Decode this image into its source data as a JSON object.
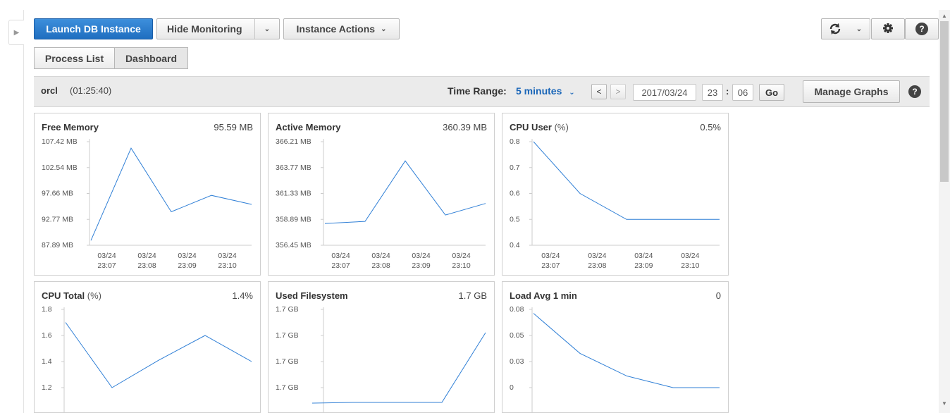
{
  "toolbar": {
    "launch_label": "Launch DB Instance",
    "hide_monitoring_label": "Hide Monitoring",
    "instance_actions_label": "Instance Actions",
    "refresh_icon": "refresh-icon",
    "settings_icon": "gear-icon",
    "help_icon": "help-icon"
  },
  "tabs": [
    {
      "label": "Process List"
    },
    {
      "label": "Dashboard"
    }
  ],
  "header": {
    "instance": "orcl",
    "uptime": "(01:25:40)",
    "time_range_label": "Time Range:",
    "time_range_value": "5 minutes",
    "prev_label": "<",
    "next_label": ">",
    "date": "2017/03/24",
    "hour": "23",
    "separator": ":",
    "minute": "06",
    "go_label": "Go",
    "manage_graphs_label": "Manage Graphs",
    "help_label": "?"
  },
  "colors": {
    "line": "#2f7fd6",
    "primary": "#2476c9",
    "link": "#1a66b8"
  },
  "cards": [
    {
      "title": "Free Memory",
      "unit": "",
      "value": "95.59 MB",
      "y_ticks": [
        "107.42 MB",
        "102.54 MB",
        "97.66 MB",
        "92.77 MB",
        "87.89 MB"
      ],
      "x_ticks": [
        [
          "03/24",
          "23:07"
        ],
        [
          "03/24",
          "23:08"
        ],
        [
          "03/24",
          "23:09"
        ],
        [
          "03/24",
          "23:10"
        ]
      ]
    },
    {
      "title": "Active Memory",
      "unit": "",
      "value": "360.39 MB",
      "y_ticks": [
        "366.21 MB",
        "363.77 MB",
        "361.33 MB",
        "358.89 MB",
        "356.45 MB"
      ],
      "x_ticks": [
        [
          "03/24",
          "23:07"
        ],
        [
          "03/24",
          "23:08"
        ],
        [
          "03/24",
          "23:09"
        ],
        [
          "03/24",
          "23:10"
        ]
      ]
    },
    {
      "title": "CPU User",
      "unit": " (%)",
      "value": "0.5%",
      "y_ticks": [
        "0.8",
        "0.7",
        "0.6",
        "0.5",
        "0.4"
      ],
      "x_ticks": [
        [
          "03/24",
          "23:07"
        ],
        [
          "03/24",
          "23:08"
        ],
        [
          "03/24",
          "23:09"
        ],
        [
          "03/24",
          "23:10"
        ]
      ]
    },
    {
      "title": "CPU Total",
      "unit": " (%)",
      "value": "1.4%",
      "y_ticks": [
        "1.8",
        "1.6",
        "1.4",
        "1.2"
      ],
      "x_ticks": []
    },
    {
      "title": "Used Filesystem",
      "unit": "",
      "value": "1.7 GB",
      "y_ticks": [
        "1.7 GB",
        "1.7 GB",
        "1.7 GB",
        "1.7 GB"
      ],
      "x_ticks": []
    },
    {
      "title": "Load Avg 1 min",
      "unit": "",
      "value": "0",
      "y_ticks": [
        "0.08",
        "0.05",
        "0.03",
        "0"
      ],
      "x_ticks": []
    }
  ],
  "chart_data": [
    {
      "type": "line",
      "title": "Free Memory",
      "ylabel": "",
      "ylim": [
        87.89,
        107.42
      ],
      "x": [
        "23:06:40",
        "23:07:40",
        "23:08:40",
        "23:09:40",
        "23:10:40"
      ],
      "values": [
        88.8,
        106.2,
        94.2,
        97.3,
        95.59
      ]
    },
    {
      "type": "line",
      "title": "Active Memory",
      "ylabel": "",
      "ylim": [
        356.45,
        366.21
      ],
      "x": [
        "23:06:40",
        "23:07:40",
        "23:08:40",
        "23:09:40",
        "23:10:40"
      ],
      "values": [
        358.5,
        358.7,
        364.4,
        359.3,
        360.39
      ]
    },
    {
      "type": "line",
      "title": "CPU User (%)",
      "ylabel": "",
      "ylim": [
        0.4,
        0.8
      ],
      "x": [
        "23:06:40",
        "23:07:40",
        "23:08:40",
        "23:09:40",
        "23:10:40"
      ],
      "values": [
        0.8,
        0.6,
        0.5,
        0.5,
        0.5
      ]
    },
    {
      "type": "line",
      "title": "CPU Total (%)",
      "ylabel": "",
      "ylim": [
        1.1,
        1.8
      ],
      "x": [
        "23:06:40",
        "23:07:40",
        "23:08:40",
        "23:09:40",
        "23:10:40"
      ],
      "values": [
        1.7,
        1.2,
        1.41,
        1.6,
        1.4
      ]
    },
    {
      "type": "line",
      "title": "Used Filesystem",
      "ylabel": "",
      "ylim": [
        0,
        1
      ],
      "x": [
        "23:06:40",
        "23:07:40",
        "23:08:40",
        "23:09:40",
        "23:10:40"
      ],
      "values": [
        0.0,
        0.005,
        0.005,
        0.005,
        0.8
      ]
    },
    {
      "type": "line",
      "title": "Load Avg 1 min",
      "ylabel": "",
      "ylim": [
        0,
        0.08
      ],
      "x": [
        "23:06:40",
        "23:07:40",
        "23:08:40",
        "23:09:40",
        "23:10:40"
      ],
      "values": [
        0.076,
        0.035,
        0.012,
        0.0,
        0.0
      ]
    }
  ]
}
